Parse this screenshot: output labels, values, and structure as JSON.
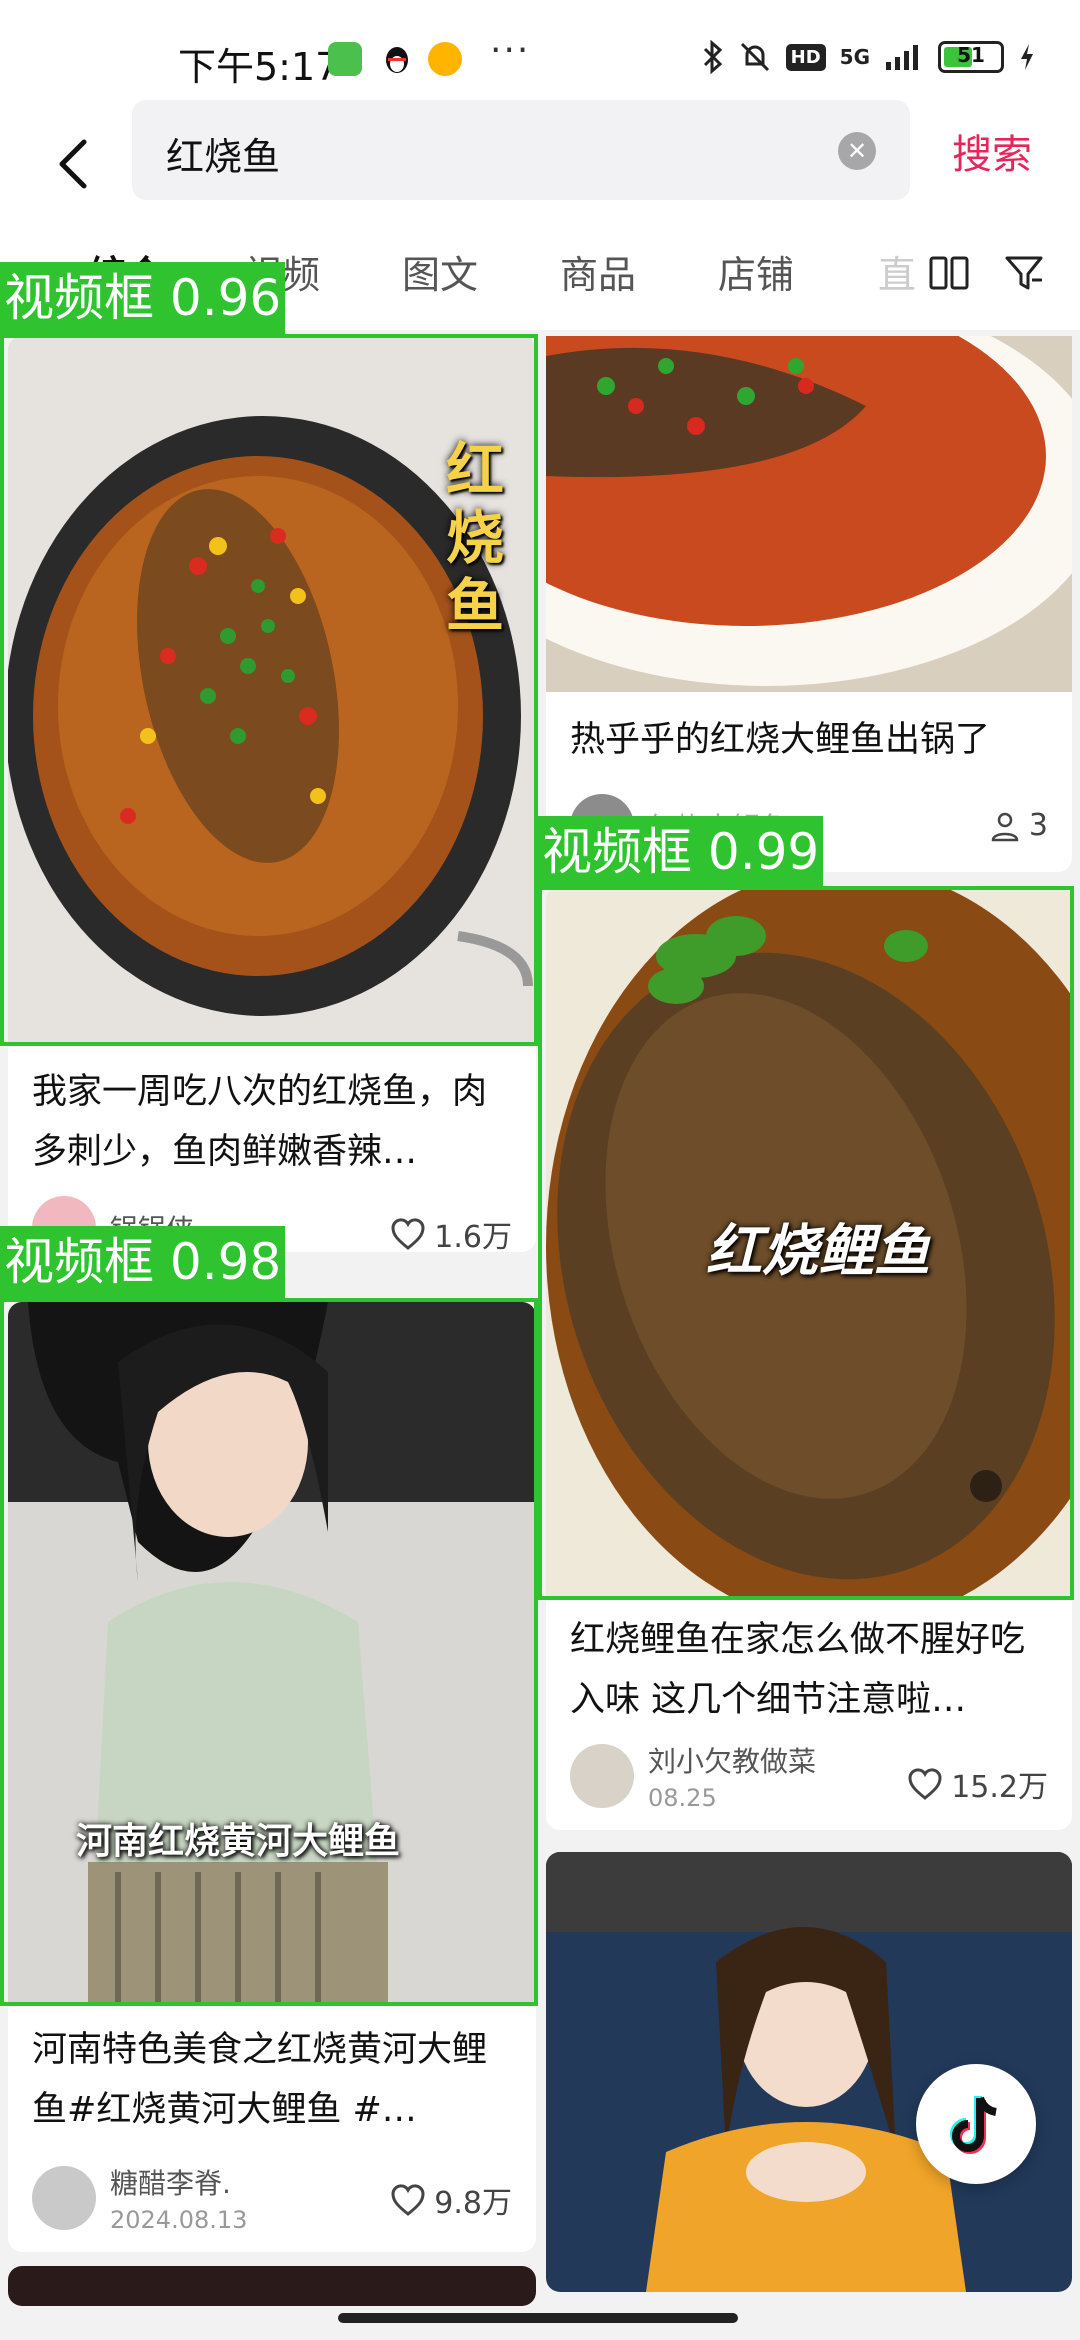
{
  "status_bar": {
    "time": "下午5:17",
    "network": "5G",
    "hd": "HD",
    "battery": "51",
    "battery_level": 0.51
  },
  "search": {
    "query": "红烧鱼",
    "submit_label": "搜索"
  },
  "tabs": [
    {
      "label": "综合",
      "active": true
    },
    {
      "label": "视频",
      "active": false
    },
    {
      "label": "图文",
      "active": false
    },
    {
      "label": "商品",
      "active": false
    },
    {
      "label": "店铺",
      "active": false
    },
    {
      "label": "直",
      "active": false
    }
  ],
  "cards": [
    {
      "title": "我家一周吃八次的红烧鱼，肉多刺少，鱼肉鲜嫩香辣…",
      "overlay": "红烧鱼",
      "author": "锅锅侠",
      "date": "",
      "likes": "1.6万"
    },
    {
      "title": "热乎乎的红烧大鲤鱼出锅了",
      "overlay": "",
      "author": "红烧大鲤鱼",
      "date": "",
      "likes": "3"
    },
    {
      "title": "红烧鲤鱼在家怎么做不腥好吃入味 这几个细节注意啦…",
      "overlay": "红烧鲤鱼",
      "author": "刘小欠教做菜",
      "date": "08.25",
      "likes": "15.2万"
    },
    {
      "title": "河南特色美食之红烧黄河大鲤鱼#红烧黄河大鲤鱼 #…",
      "overlay": "河南红烧黄河大鲤鱼",
      "author": "糖醋李脊.",
      "date": "2024.08.13",
      "likes": "9.8万"
    }
  ],
  "detections": [
    {
      "label": "视频框 0.96"
    },
    {
      "label": "视频框 0.99"
    },
    {
      "label": "视频框 0.98"
    }
  ],
  "colors": {
    "accent": "#e5255b",
    "detection": "#2fc42f"
  }
}
